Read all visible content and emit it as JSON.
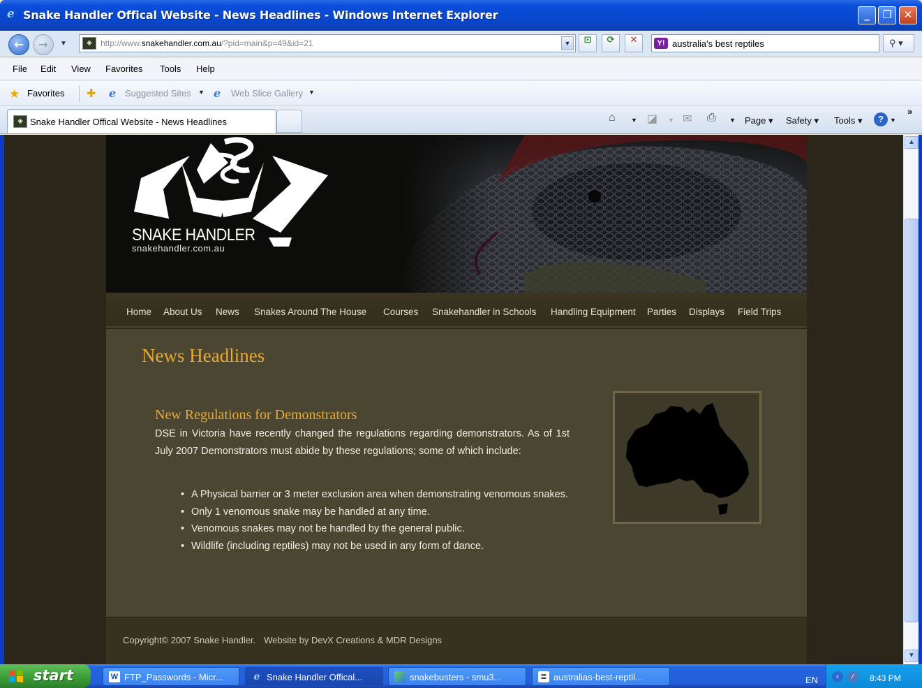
{
  "window": {
    "title": "Snake Handler Offical Website - News Headlines - Windows Internet Explorer",
    "buttons": {
      "minimize": "_",
      "restore": "❐",
      "close": "✕"
    }
  },
  "address_bar": {
    "url_prefix": "http://www.",
    "url_domain": "snakehandler.com.au",
    "url_path": "/?pid=main&p=49&id=21",
    "search_value": "australia's best reptiles"
  },
  "menu": [
    "File",
    "Edit",
    "View",
    "Favorites",
    "Tools",
    "Help"
  ],
  "favorites_bar": {
    "favorites_label": "Favorites",
    "suggested_sites": "Suggested Sites",
    "web_slice_gallery": "Web Slice Gallery"
  },
  "tabs": [
    {
      "label": "Snake Handler Offical Website - News Headlines"
    }
  ],
  "command_bar": {
    "page": "Page",
    "safety": "Safety",
    "tools": "Tools",
    "more": "»"
  },
  "site": {
    "logo_title": "SNAKE HANDLER",
    "logo_subtitle": "snakehandler.com.au",
    "nav": [
      "Home",
      "About Us",
      "News",
      "Snakes Around The House",
      "Courses",
      "Snakehandler in Schools",
      "Handling Equipment",
      "Parties",
      "Displays",
      "Field Trips"
    ],
    "page_title": "News Headlines",
    "article": {
      "title": "New Regulations for Demonstrators",
      "body": "DSE in Victoria have recently changed the regulations regarding demonstrators.  As of 1st July 2007 Demonstrators must abide by these regulations; some of which include:",
      "bullets": [
        "A Physical barrier or 3 meter exclusion area when demonstrating venomous snakes.",
        "Only 1 venomous snake may be handled at any time.",
        "Venomous snakes may not be handled by the general public.",
        "Wildlife (including reptiles) may not be used in any form of dance."
      ]
    },
    "footer": {
      "copyright": "Copyright© 2007 Snake Handler.",
      "credits": "Website by DevX Creations & MDR Designs"
    },
    "colors": {
      "accent": "#e6a93a",
      "content_bg": "#4b4632",
      "page_bg": "#2b2619"
    }
  },
  "taskbar": {
    "start_label": "start",
    "tasks": [
      {
        "label": "FTP_Passwords - Micr...",
        "icon": "word-icon"
      },
      {
        "label": "Snake Handler Offical...",
        "icon": "ie-icon"
      },
      {
        "label": "snakebusters - smu3...",
        "icon": "app-icon"
      },
      {
        "label": "australias-best-reptil...",
        "icon": "notepad-icon"
      }
    ],
    "language": "EN",
    "clock": "8:43 PM"
  }
}
